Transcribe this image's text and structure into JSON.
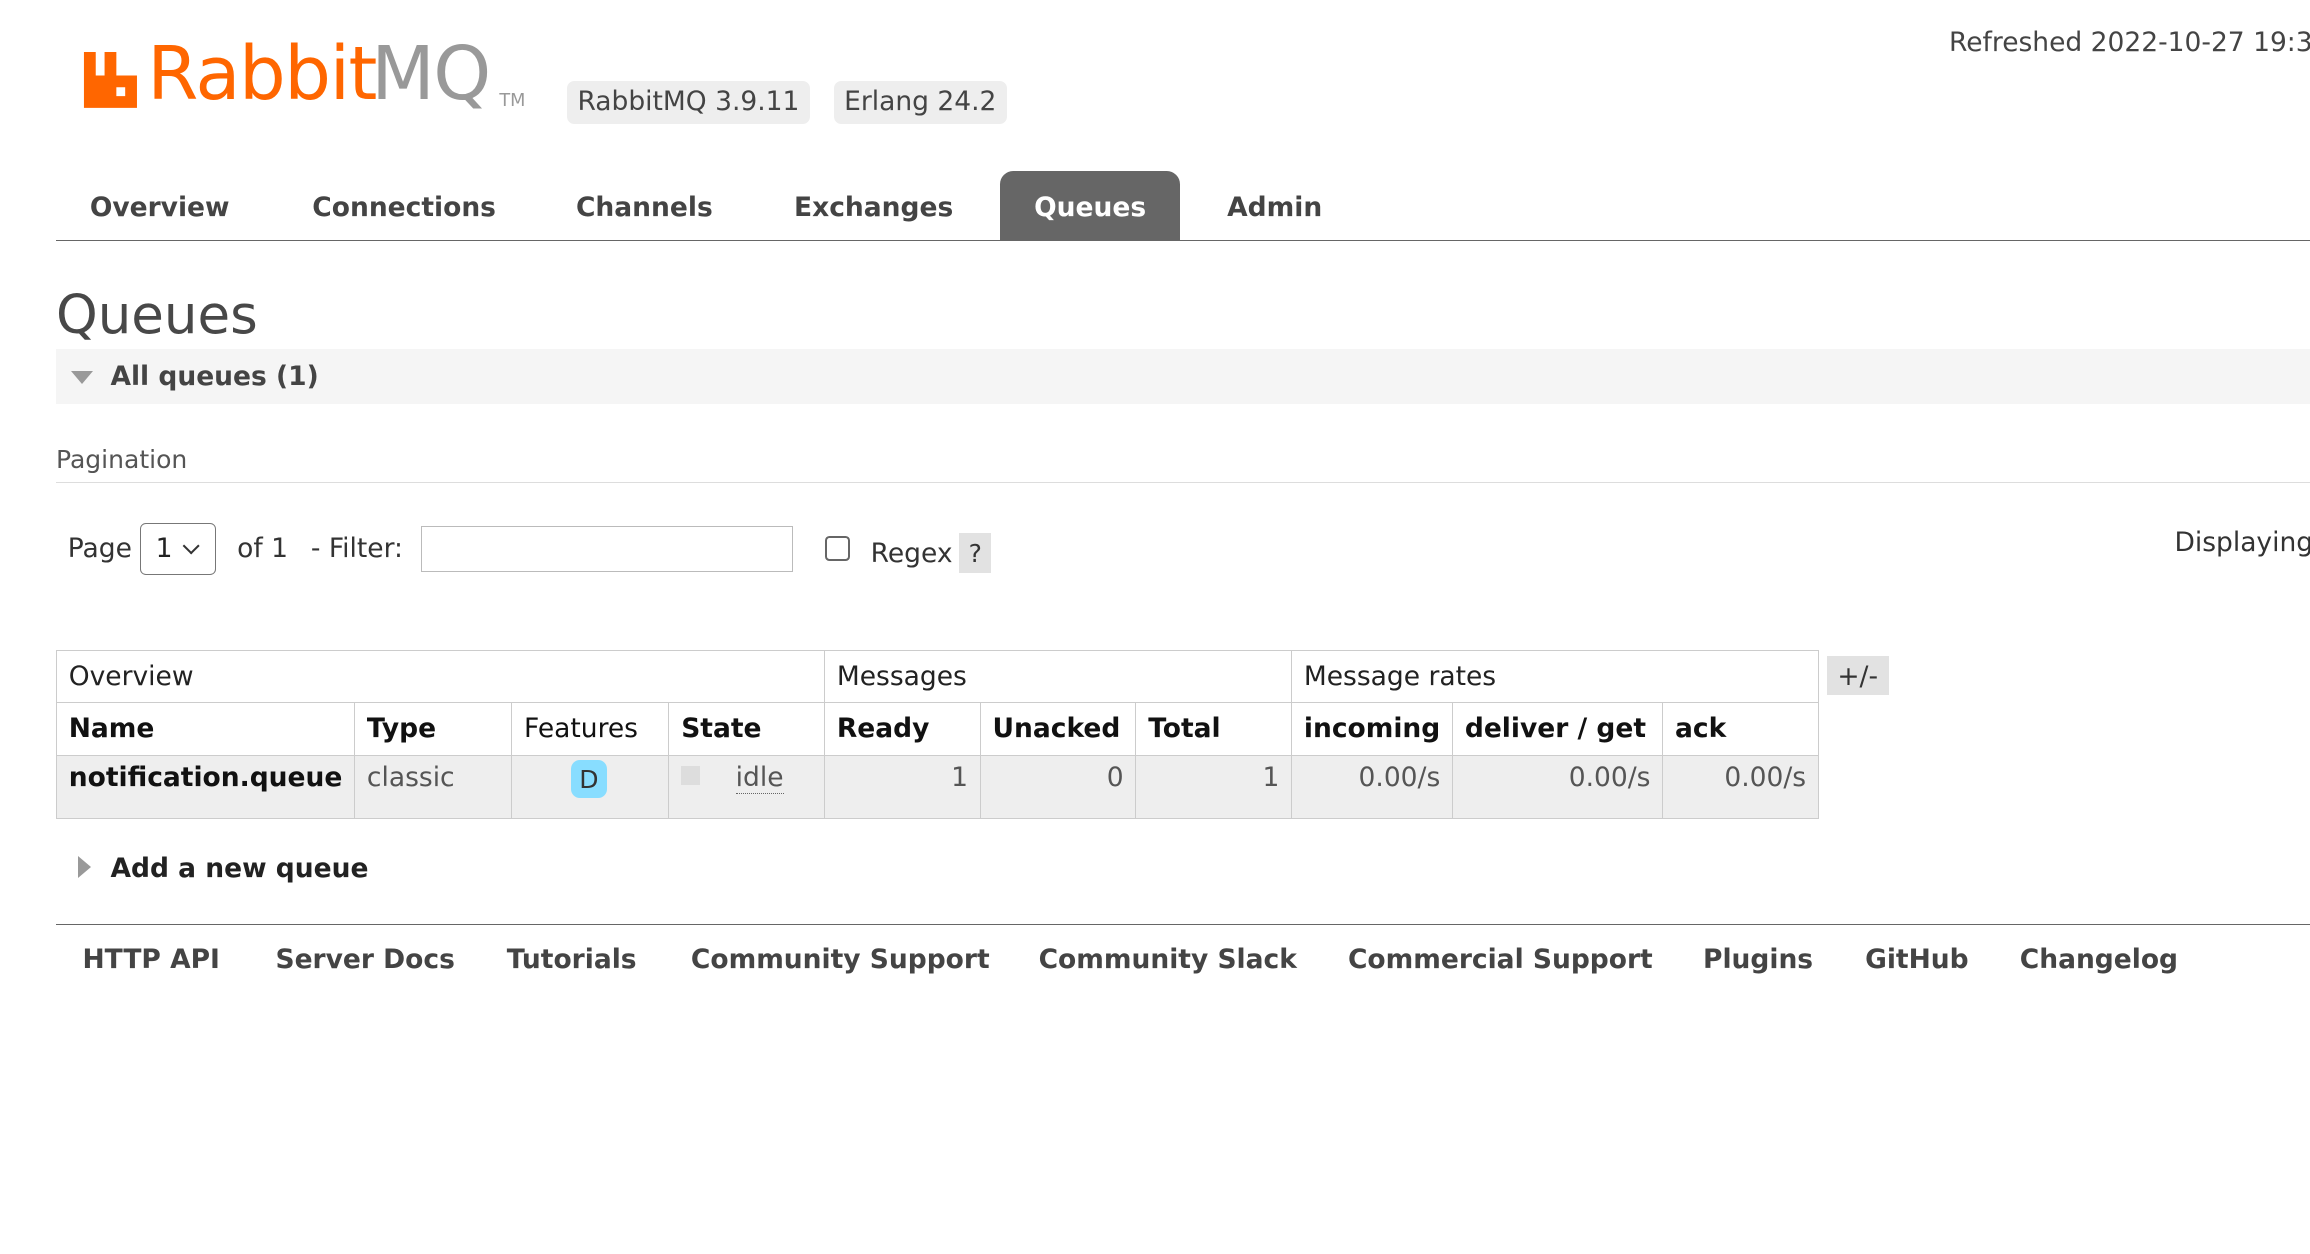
{
  "header": {
    "logo_primary": "Rabbit",
    "logo_secondary": "MQ",
    "logo_tm": "TM",
    "version_badge": "RabbitMQ 3.9.11",
    "erlang_badge": "Erlang 24.2",
    "refreshed": "Refreshed 2022-10-27 19:3"
  },
  "tabs": [
    {
      "label": "Overview",
      "active": false
    },
    {
      "label": "Connections",
      "active": false
    },
    {
      "label": "Channels",
      "active": false
    },
    {
      "label": "Exchanges",
      "active": false
    },
    {
      "label": "Queues",
      "active": true
    },
    {
      "label": "Admin",
      "active": false
    }
  ],
  "page_title": "Queues",
  "section": {
    "title": "All queues (1)"
  },
  "pagination": {
    "label": "Pagination",
    "page_label": "Page",
    "page_value": "1",
    "of_label": "of 1",
    "filter_label": "- Filter:",
    "filter_value": "",
    "regex_label": "Regex",
    "regex_checked": false,
    "help": "?",
    "displaying": "Displaying"
  },
  "table": {
    "groups": [
      "Overview",
      "Messages",
      "Message rates"
    ],
    "columns": [
      "Name",
      "Type",
      "Features",
      "State",
      "Ready",
      "Unacked",
      "Total",
      "incoming",
      "deliver / get",
      "ack"
    ],
    "rows": [
      {
        "name": "notification.queue",
        "type": "classic",
        "feature": "D",
        "state": "idle",
        "ready": "1",
        "unacked": "0",
        "total": "1",
        "incoming": "0.00/s",
        "deliver_get": "0.00/s",
        "ack": "0.00/s"
      }
    ],
    "toggle_columns": "+/-"
  },
  "add_queue": "Add a new queue",
  "footer": [
    "HTTP API",
    "Server Docs",
    "Tutorials",
    "Community Support",
    "Community Slack",
    "Commercial Support",
    "Plugins",
    "GitHub",
    "Changelog"
  ],
  "colors": {
    "brand": "#ff6600",
    "tab_active": "#666666",
    "feature_badge": "#88ddff"
  }
}
